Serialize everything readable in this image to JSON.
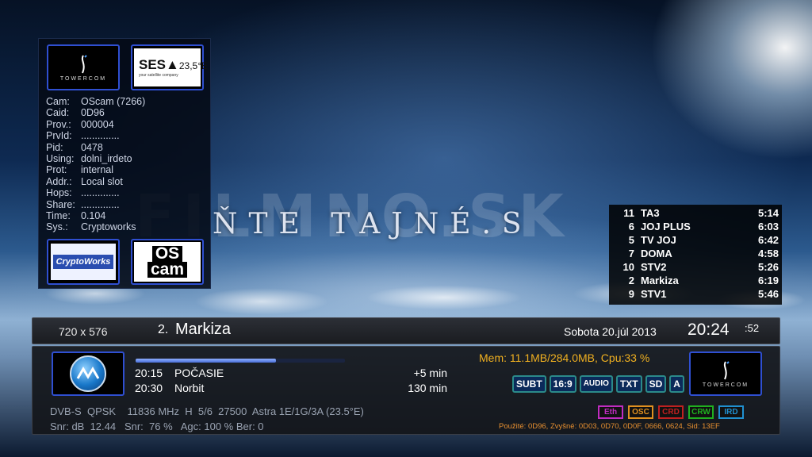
{
  "background": {
    "headline": "ŇTE TAJNÉ.S",
    "watermark": "FILMNO.SK"
  },
  "info_panel": {
    "provider_logo": "TOWERCOM",
    "satellite_logo": {
      "name": "SES",
      "position": "23,5°E",
      "tagline": "your satellite company"
    },
    "rows": [
      {
        "key": "Cam:",
        "value": "OScam (7266)"
      },
      {
        "key": "Caid:",
        "value": "0D96"
      },
      {
        "key": "Prov.:",
        "value": "000004"
      },
      {
        "key": "PrvId:",
        "value": ".............."
      },
      {
        "key": "Pid:",
        "value": "0478"
      },
      {
        "key": "Using:",
        "value": "dolni_irdeto"
      },
      {
        "key": "Prot:",
        "value": "internal"
      },
      {
        "key": "Addr.:",
        "value": "Local slot"
      },
      {
        "key": "Hops:",
        "value": ".............."
      },
      {
        "key": "Share:",
        "value": ".............."
      },
      {
        "key": "Time:",
        "value": "0.104"
      },
      {
        "key": "Sys.:",
        "value": "Cryptoworks"
      }
    ],
    "cas_logo": "CryptoWorks",
    "emu_logo": {
      "line1": "OS",
      "line2": "cam"
    }
  },
  "channel_list": [
    {
      "num": "11",
      "name": "TA3",
      "time": "5:14"
    },
    {
      "num": "6",
      "name": "JOJ PLUS",
      "time": "6:03"
    },
    {
      "num": "5",
      "name": "TV JOJ",
      "time": "6:42"
    },
    {
      "num": "7",
      "name": "DOMA",
      "time": "4:58"
    },
    {
      "num": "10",
      "name": "STV2",
      "time": "5:26"
    },
    {
      "num": "2",
      "name": "Markiza",
      "time": "6:19"
    },
    {
      "num": "9",
      "name": "STV1",
      "time": "5:46"
    }
  ],
  "title_bar": {
    "resolution": "720 x 576",
    "channel_number": "2.",
    "channel_name": "Markiza",
    "date": "Sobota  20.júl 2013",
    "time": "20:24",
    "seconds": ":52"
  },
  "bottom": {
    "progress": 0.67,
    "epg": [
      {
        "time": "20:15",
        "title": "POČASIE",
        "duration": "+5 min"
      },
      {
        "time": "20:30",
        "title": "Norbit",
        "duration": "130 min"
      }
    ],
    "mem": "Mem: 11.1MB/284.0MB, Cpu:33 %",
    "badges": [
      "SUBT",
      "16:9",
      "AUDIO",
      "TXT",
      "SD",
      "A"
    ],
    "tech_line1": "DVB-S  QPSK    11836 MHz  H  5/6  27500  Astra 1E/1G/3A (23.5°E)",
    "tech_line2": "Snr: dB  12.44   Snr:  76 %   Agc: 100 % Ber: 0",
    "cas_badges": [
      {
        "label": "Eth",
        "color": "#c02cc0"
      },
      {
        "label": "OSC",
        "color": "#e09020"
      },
      {
        "label": "CRD",
        "color": "#c02020"
      },
      {
        "label": "CRW",
        "color": "#20b020"
      },
      {
        "label": "IRD",
        "color": "#2090d0"
      }
    ],
    "used_caids": "Použité: 0D96, Zvyšné: 0D03, 0D70, 0D0F, 0666, 0624, Sid: 13EF"
  }
}
